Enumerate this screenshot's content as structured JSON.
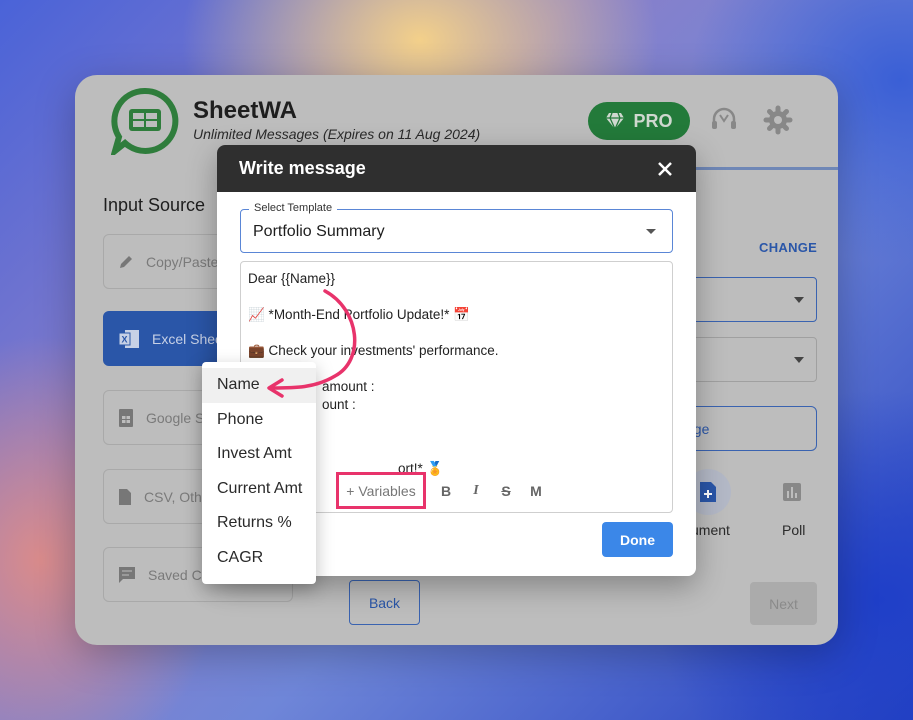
{
  "app": {
    "title": "SheetWA",
    "subtitle": "Unlimited Messages (Expires on 11 Aug 2024)",
    "pro_label": "PRO"
  },
  "input_source": {
    "title": "Input Source",
    "items": [
      {
        "label": "Copy/Paste",
        "icon": "pencil-icon"
      },
      {
        "label": "Excel Shee",
        "icon": "excel-icon",
        "active": true
      },
      {
        "label": "Google S",
        "icon": "sheets-icon"
      },
      {
        "label": "CSV, Othe",
        "icon": "file-icon"
      },
      {
        "label": "Saved C",
        "icon": "chat-icon"
      }
    ]
  },
  "right_panel": {
    "change_label": "CHANGE",
    "age_label": "age",
    "document_label": "ument",
    "poll_label": "Poll"
  },
  "nav": {
    "back_label": "Back",
    "next_label": "Next"
  },
  "dialog": {
    "title": "Write message",
    "template_label": "Select Template",
    "template_value": "Portfolio Summary",
    "message_lines": [
      "Dear {{Name}}",
      "",
      "📈 *Month-End Portfolio Update!* 📅",
      "",
      "💼 Check your investments' performance.",
      "",
      "amount :",
      "ount :",
      "",
      "",
      "",
      "ort!* 🏅"
    ],
    "variables_label": "+ Variables",
    "format_buttons": [
      "B",
      "I",
      "S",
      "M"
    ],
    "done_label": "Done"
  },
  "variables_menu": [
    "Name",
    "Phone",
    "Invest Amt",
    "Current Amt",
    "Returns %",
    "CAGR"
  ],
  "colors": {
    "accent": "#2a56a8",
    "pro_green": "#237a3a",
    "highlight": "#e8336b",
    "done_blue": "#3b87e8"
  }
}
